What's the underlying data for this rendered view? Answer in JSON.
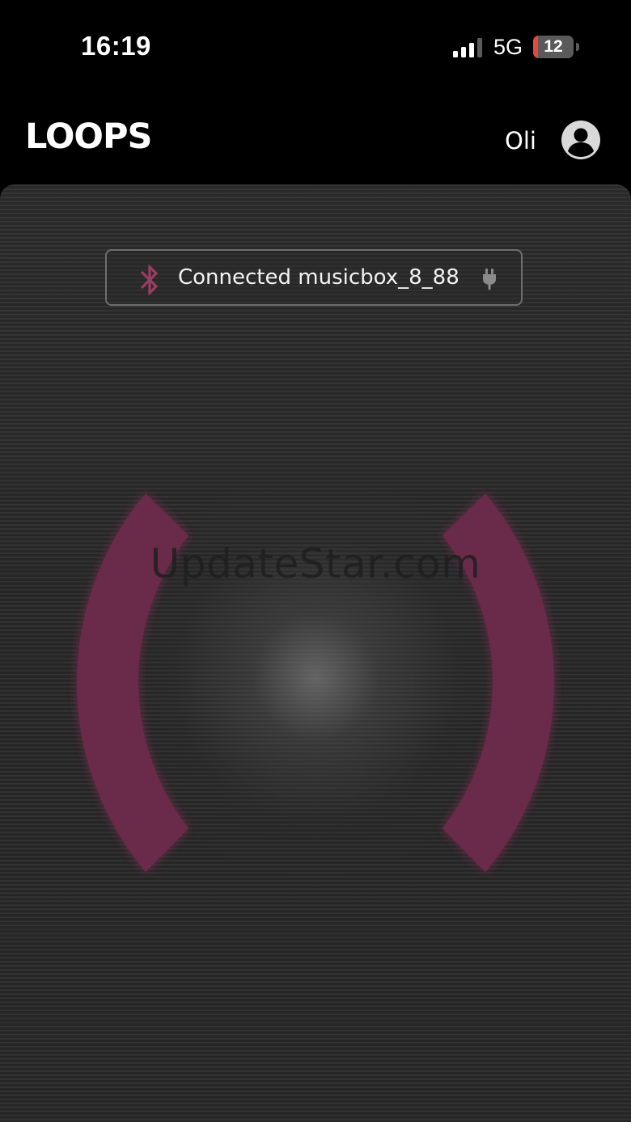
{
  "status_bar": {
    "time": "16:19",
    "network": "5G",
    "battery_level": "12",
    "battery_fraction": 0.12,
    "signal_bars_active": 3,
    "signal_bars_total": 4,
    "signal_icon": "cellular-signal-icon",
    "battery_icon": "battery-icon"
  },
  "header": {
    "brand": "LOOPS",
    "user_name": "Oli",
    "avatar_icon": "user-avatar-icon"
  },
  "connection": {
    "status_text": "Connected musicbox_8_88",
    "bluetooth_icon": "bluetooth-icon",
    "plug_icon": "plug-icon"
  },
  "visualizer": {
    "watermark": "UpdateStar.com"
  },
  "colors": {
    "background": "#000000",
    "panel": "#2c2c2c",
    "accent": "#6b2a48",
    "bluetooth": "#9b3d63",
    "badge_border": "#6e6e6e"
  }
}
